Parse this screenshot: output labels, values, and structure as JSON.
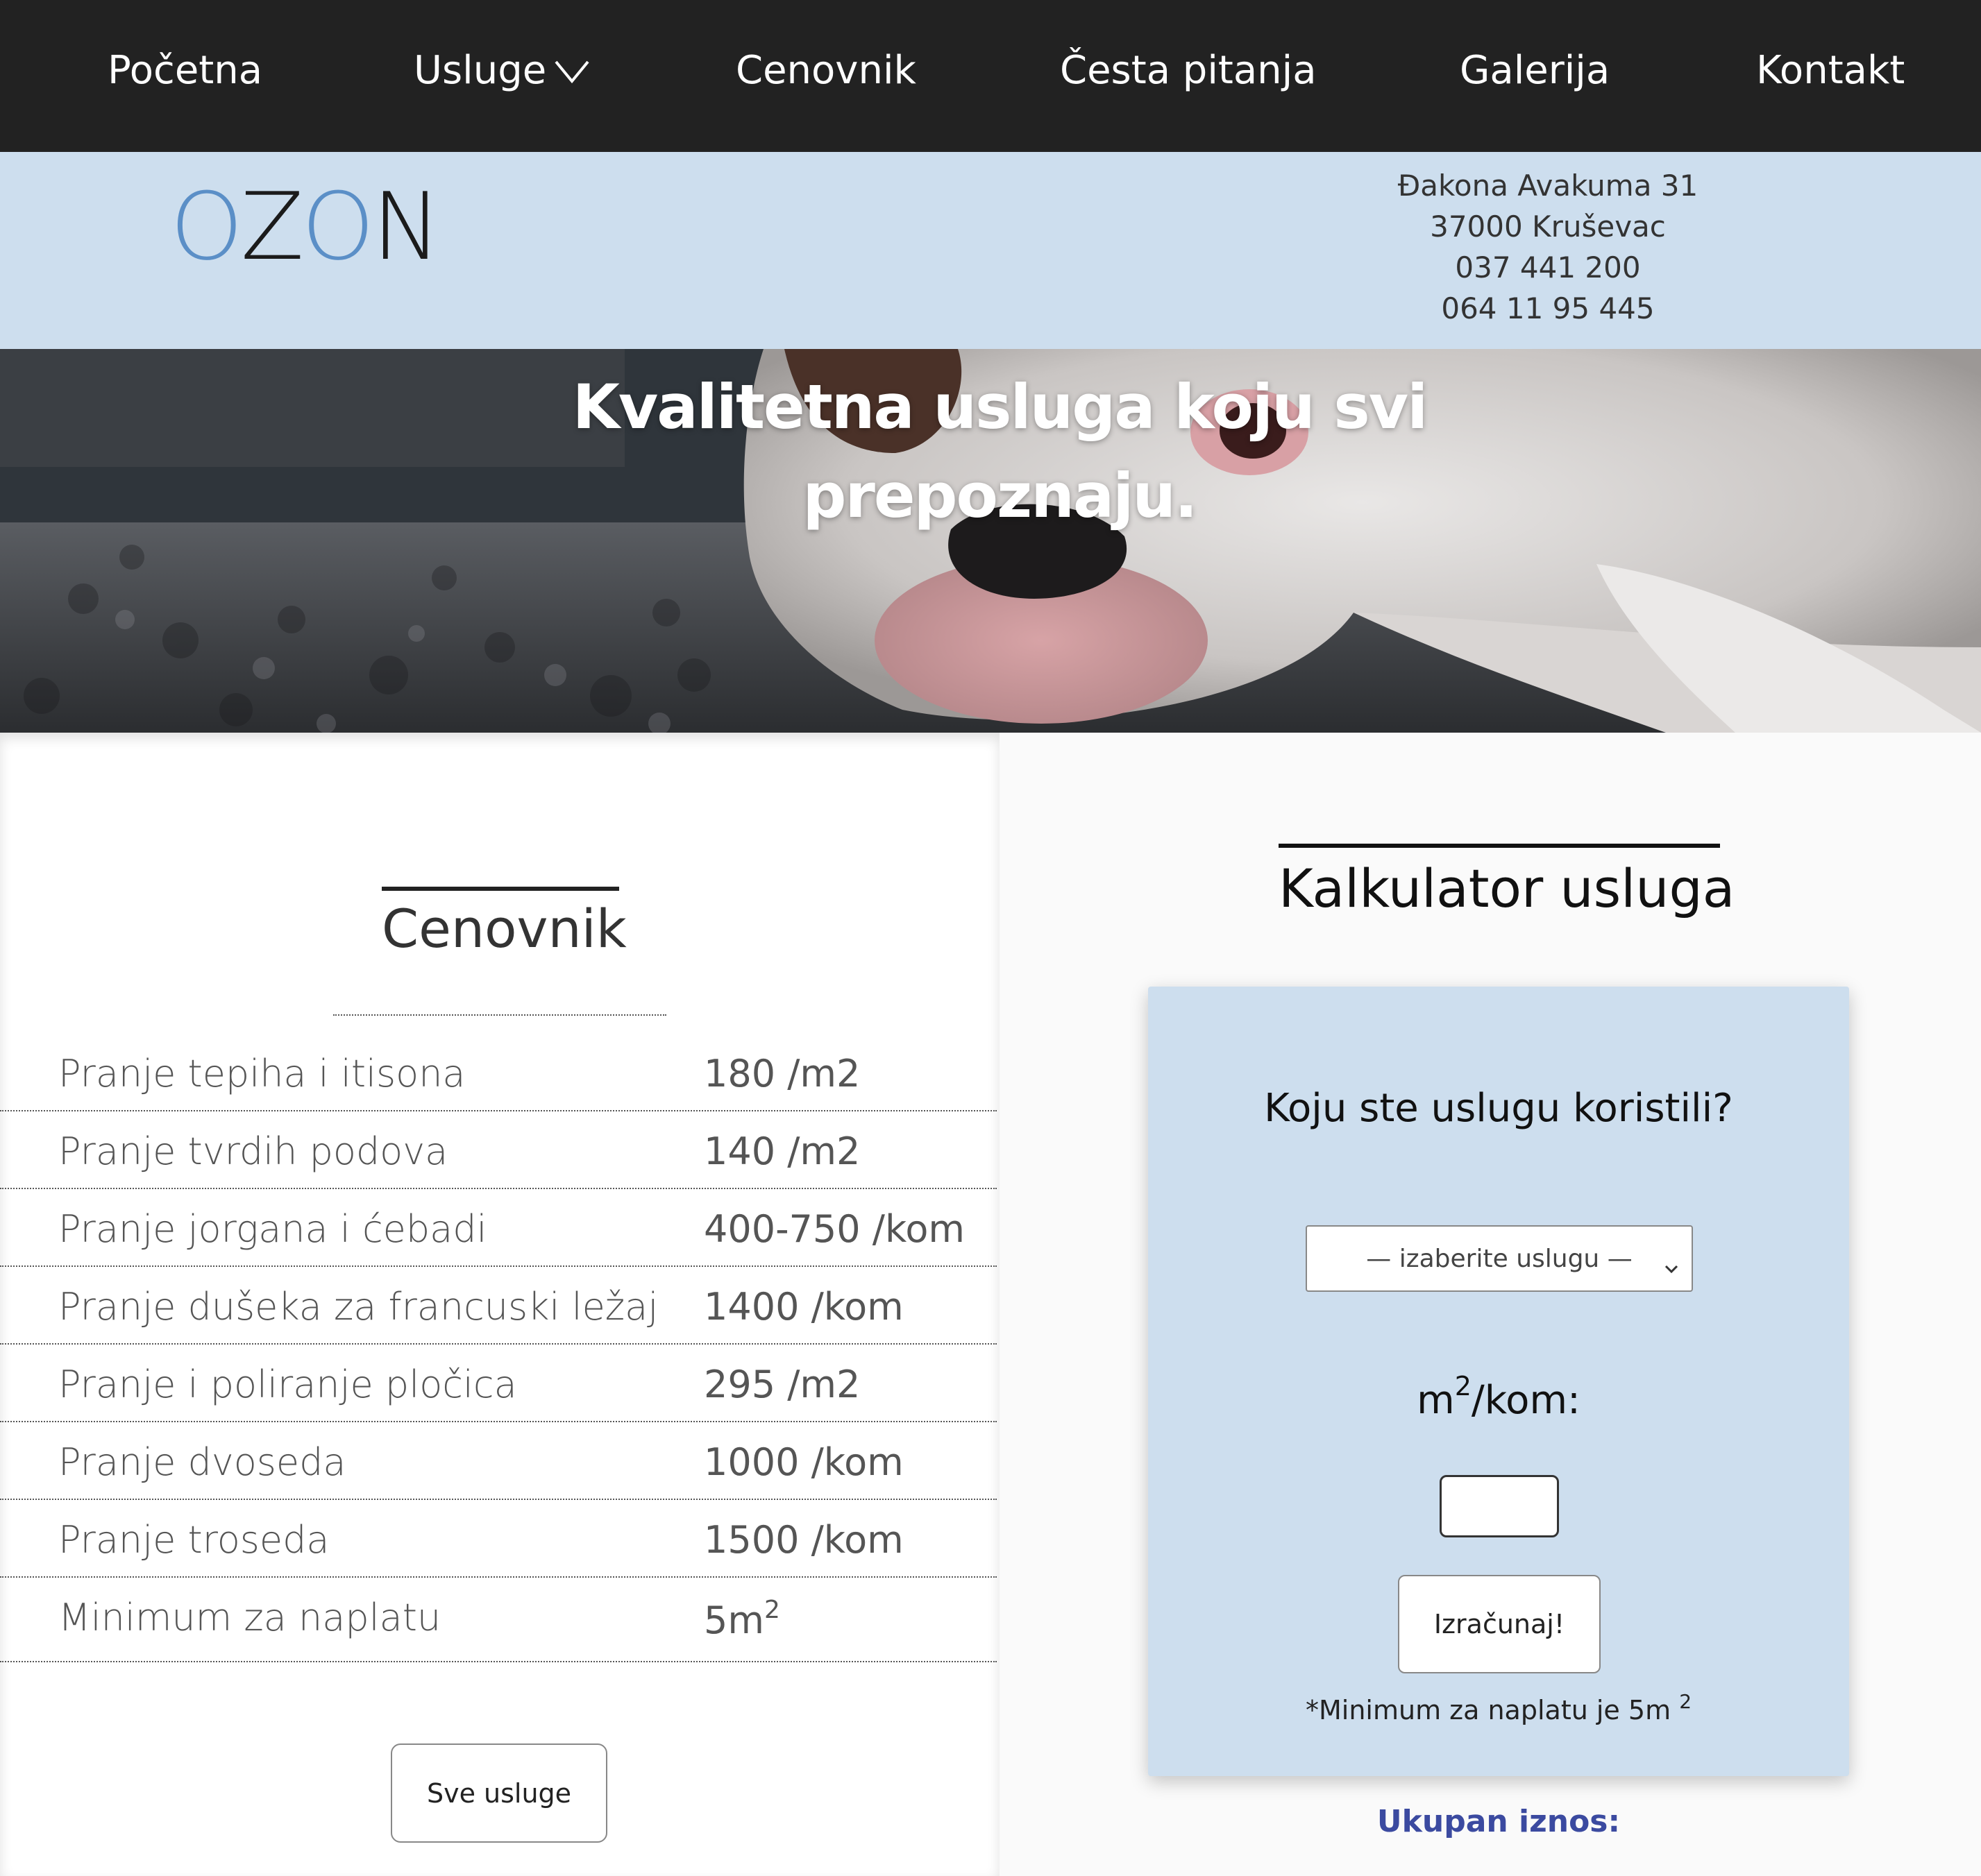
{
  "nav": {
    "items": [
      {
        "label": "Početna"
      },
      {
        "label": "Usluge"
      },
      {
        "label": "Cenovnik"
      },
      {
        "label": "Česta pitanja"
      },
      {
        "label": "Galerija"
      },
      {
        "label": "Kontakt"
      }
    ]
  },
  "header": {
    "logo": {
      "part1": "O",
      "part2": "Z",
      "part3": "O",
      "part4": "N"
    },
    "address": {
      "street": "Đakona Avakuma 31",
      "city": "37000 Kruševac",
      "phone1": "037 441 200",
      "phone2": "064 11 95 445"
    }
  },
  "hero": {
    "line1": "Kvalitetna usluga koju svi",
    "line2": "prepoznaju."
  },
  "pricelist": {
    "title": "Cenovnik",
    "rows": [
      {
        "name": "Pranje tepiha i itisona",
        "price": "180 /m2"
      },
      {
        "name": "Pranje tvrdih podova",
        "price": "140 /m2"
      },
      {
        "name": "Pranje jorgana i ćebadi",
        "price": "400-750 /kom"
      },
      {
        "name": "Pranje dušeka za francuski ležaj",
        "price": "1400 /kom"
      },
      {
        "name": "Pranje i poliranje pločica",
        "price": "295 /m2"
      },
      {
        "name": "Pranje dvoseda",
        "price": "1000 /kom"
      },
      {
        "name": "Pranje troseda",
        "price": "1500 /kom"
      },
      {
        "name": "Minimum za naplatu",
        "price": "5m",
        "price_sup": "2"
      }
    ],
    "button": "Sve usluge"
  },
  "calculator": {
    "title": "Kalkulator usluga",
    "question": "Koju ste uslugu koristili?",
    "select_value": "— izaberite uslugu —",
    "unit_pre": "m",
    "unit_sup": "2",
    "unit_post": "/kom:",
    "input_value": "",
    "button": "Izračunaj!",
    "note": "*Minimum za naplatu je 5m",
    "note_sup": "2",
    "total_label": "Ukupan iznos:"
  },
  "colors": {
    "nav_bg": "#222222",
    "header_bg": "#cddeee",
    "logo_blue": "#5b8fc7",
    "total_blue": "#3b4aa0"
  },
  "icons": {
    "usluge_dropdown": "chevron-down-icon",
    "select_caret": "chevron-down-icon"
  }
}
